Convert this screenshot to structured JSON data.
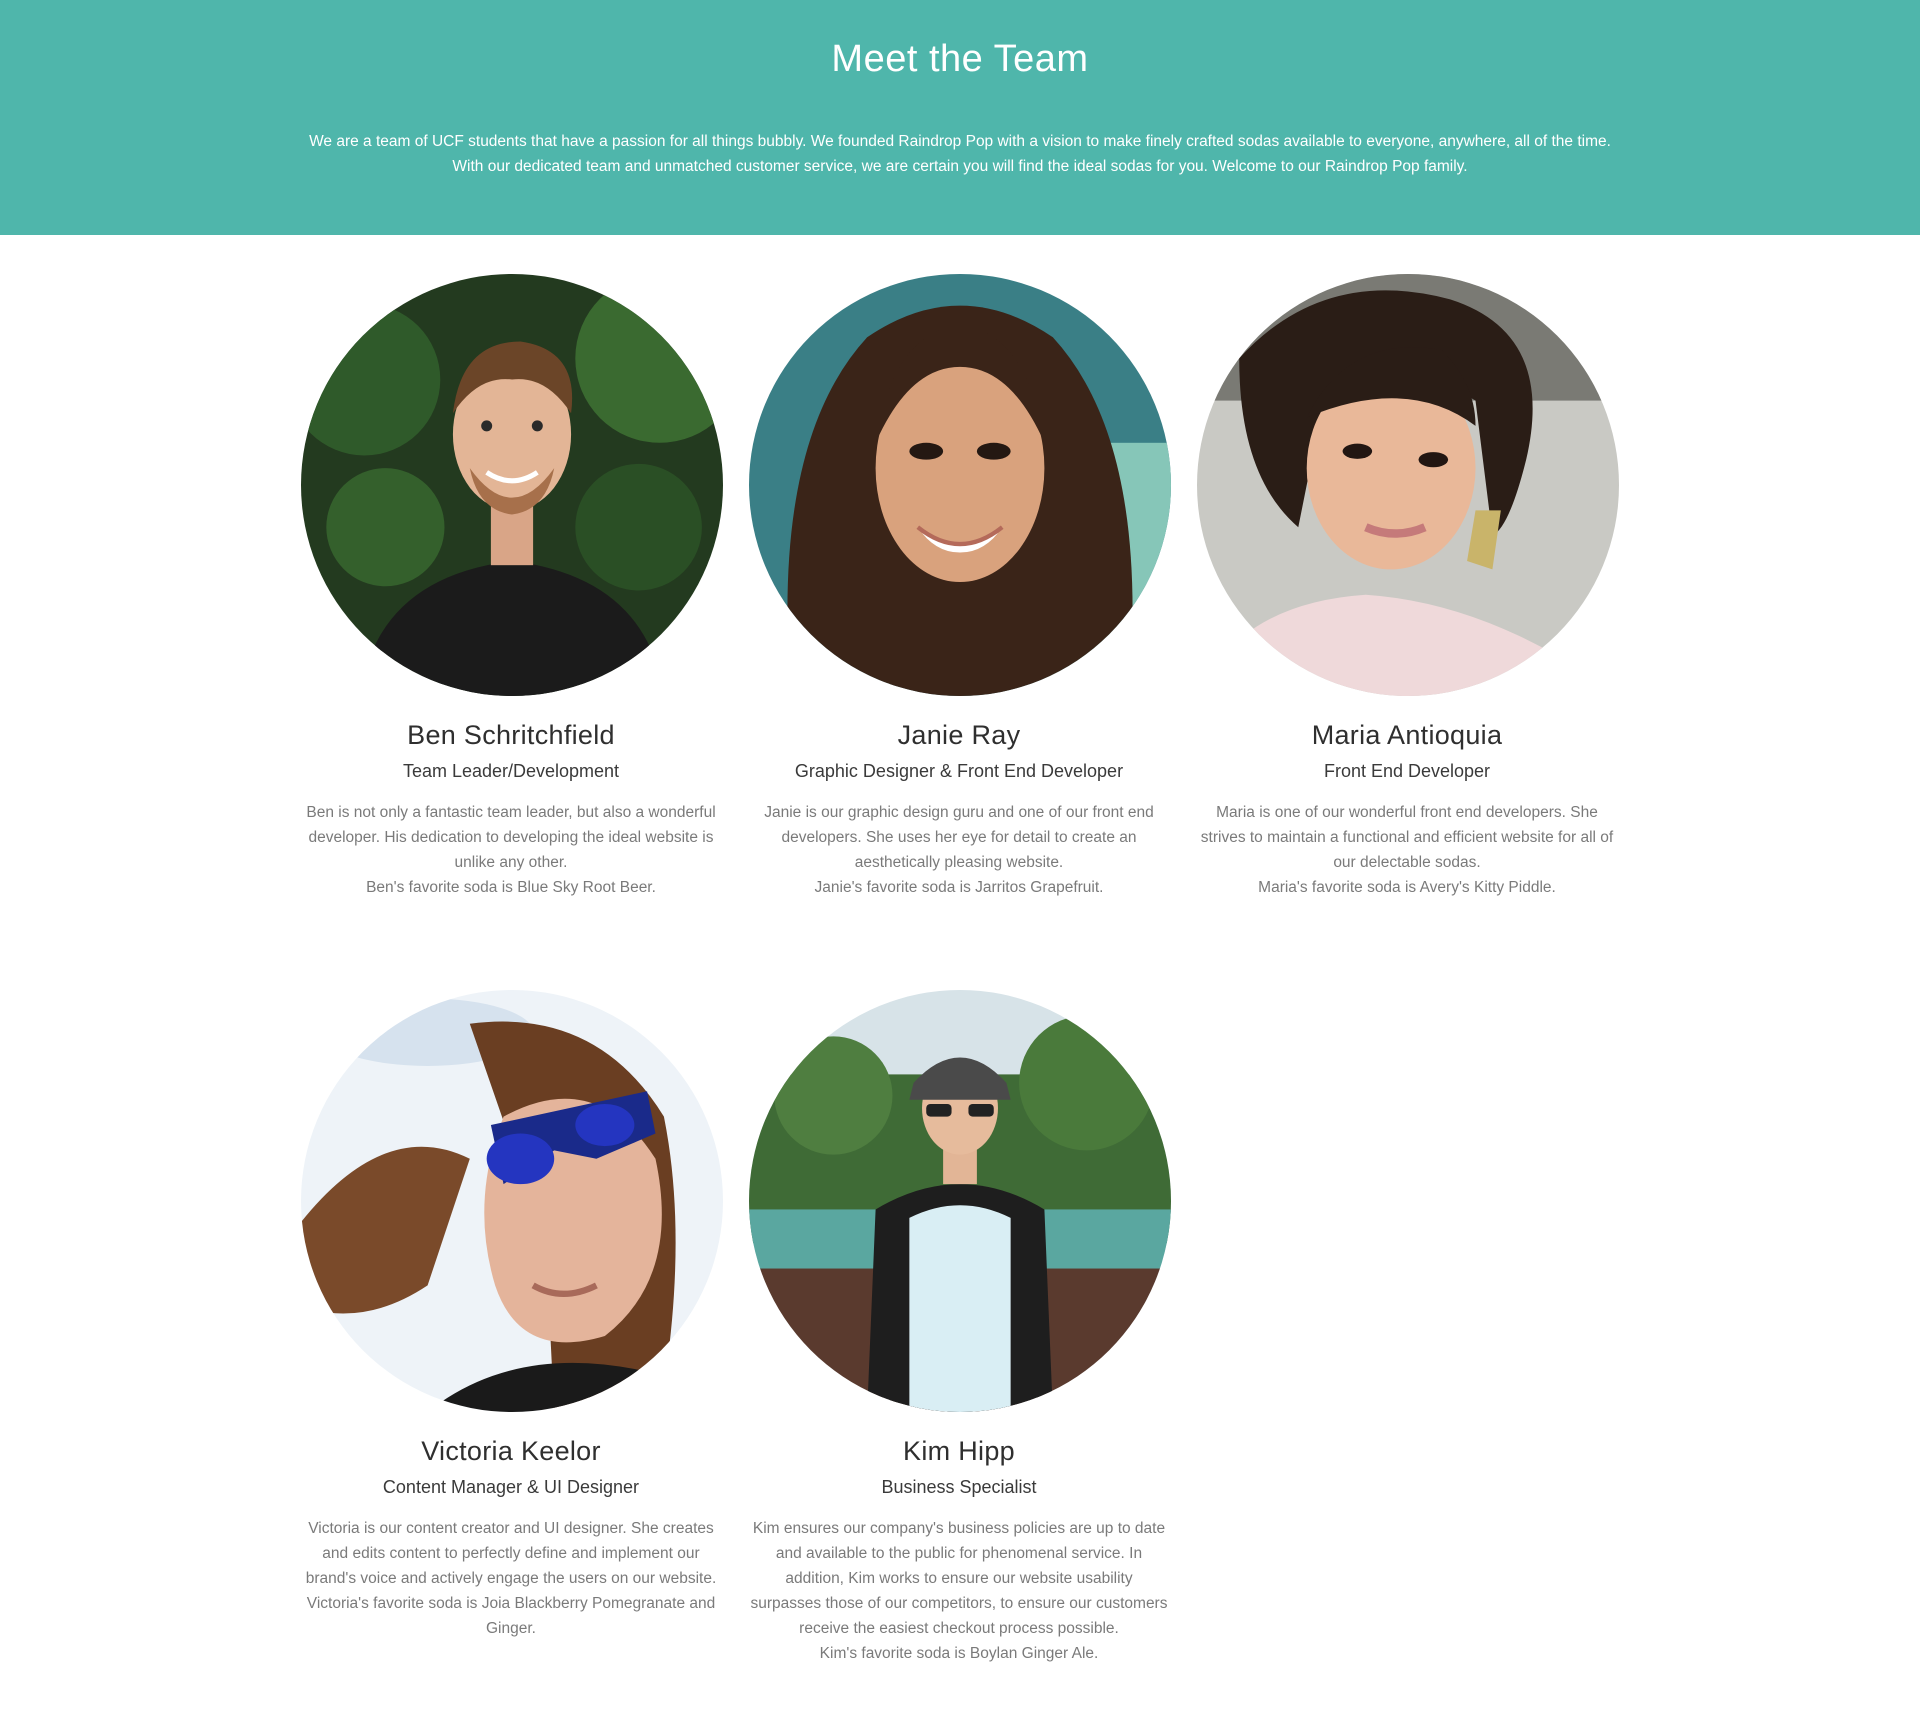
{
  "hero": {
    "title": "Meet the Team",
    "intro_line1": "We are a team of UCF students that have a passion for all things bubbly. We founded Raindrop Pop with a vision to make finely crafted sodas available to everyone, anywhere, all of the time.",
    "intro_line2": "With our dedicated team and unmatched customer service, we are certain you will find the ideal sodas for you. Welcome to our Raindrop Pop family.",
    "background_color": "#4fb6ab"
  },
  "members": [
    {
      "name": "Ben Schritchfield",
      "role": "Team Leader/Development",
      "bio": "Ben is not only a fantastic team leader, but also a wonderful developer. His dedication to developing the ideal website is unlike any other.",
      "favorite": "Ben's favorite soda is Blue Sky Root Beer."
    },
    {
      "name": "Janie Ray",
      "role": "Graphic Designer & Front End Developer",
      "bio": "Janie is our graphic design guru and one of our front end developers. She uses her eye for detail to create an aesthetically pleasing website.",
      "favorite": "Janie's favorite soda is Jarritos Grapefruit."
    },
    {
      "name": "Maria Antioquia",
      "role": "Front End Developer",
      "bio": "Maria is one of our wonderful front end developers. She strives to maintain a functional and efficient website for all of our delectable sodas.",
      "favorite": "Maria's favorite soda is Avery's Kitty Piddle."
    },
    {
      "name": "Victoria Keelor",
      "role": "Content Manager & UI Designer",
      "bio": "Victoria is our content creator and UI designer. She creates and edits content to perfectly define and implement our brand's voice and actively engage the users on our website.",
      "favorite": "Victoria's favorite soda is Joia Blackberry Pomegranate and Ginger."
    },
    {
      "name": "Kim Hipp",
      "role": "Business Specialist",
      "bio": "Kim ensures our company's business policies are up to date and available to the public for phenomenal service. In addition, Kim works to ensure our website usability surpasses those of our competitors, to ensure our customers receive the easiest checkout process possible.",
      "favorite": "Kim's favorite soda is Boylan Ginger Ale."
    }
  ]
}
